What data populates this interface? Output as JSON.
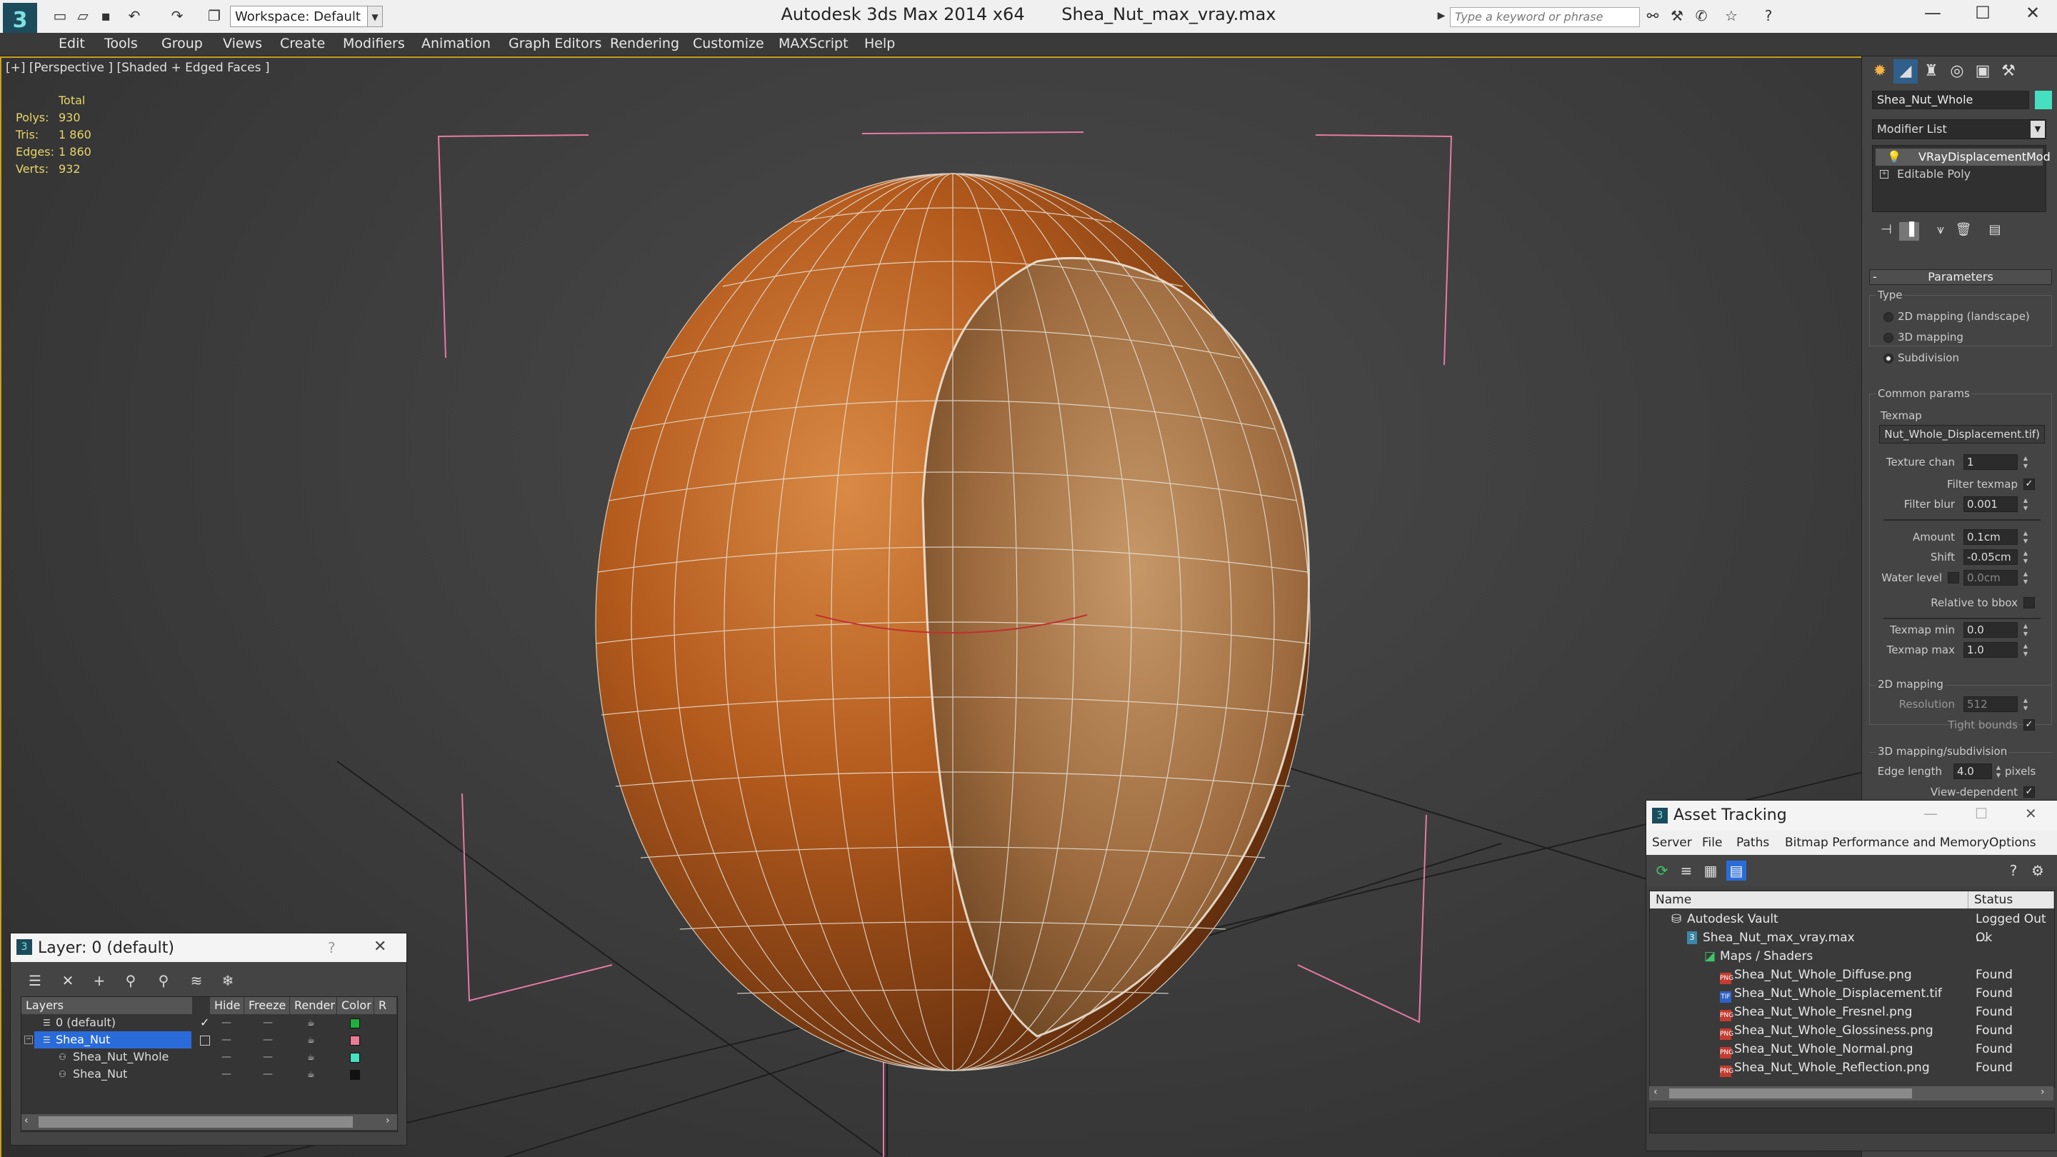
{
  "titlebar": {
    "app_title": "Autodesk 3ds Max  2014 x64",
    "file_title": "Shea_Nut_max_vray.max",
    "workspace": "Workspace: Default",
    "search_placeholder": "Type a keyword or phrase"
  },
  "menu": [
    "Edit",
    "Tools",
    "Group",
    "Views",
    "Create",
    "Modifiers",
    "Animation",
    "Graph Editors",
    "Rendering",
    "Customize",
    "MAXScript",
    "Help"
  ],
  "viewport": {
    "label": "[+] [Perspective ] [Shaded + Edged Faces ]",
    "stats": {
      "header": "Total",
      "polys_label": "Polys:",
      "polys": "930",
      "tris_label": "Tris:",
      "tris": "1 860",
      "edges_label": "Edges:",
      "edges": "1 860",
      "verts_label": "Verts:",
      "verts": "932"
    }
  },
  "command_panel": {
    "object_name": "Shea_Nut_Whole",
    "object_color": "#45e0c0",
    "modifier_list": "Modifier List",
    "stack": [
      "VRayDisplacementMod",
      "Editable Poly"
    ],
    "parameters": {
      "title": "Parameters",
      "type_group": "Type",
      "type_options": [
        "2D mapping (landscape)",
        "3D mapping",
        "Subdivision"
      ],
      "common_group": "Common params",
      "texmap_label": "Texmap",
      "texmap_value": "Nut_Whole_Displacement.tif)",
      "texture_chan_label": "Texture chan",
      "texture_chan": "1",
      "filter_texmap_label": "Filter texmap",
      "filter_blur_label": "Filter blur",
      "filter_blur": "0.001",
      "amount_label": "Amount",
      "amount": "0.1cm",
      "shift_label": "Shift",
      "shift": "-0.05cm",
      "water_level_label": "Water level",
      "water_level": "0.0cm",
      "relative_label": "Relative to bbox",
      "texmap_min_label": "Texmap min",
      "texmap_min": "0.0",
      "texmap_max_label": "Texmap max",
      "texmap_max": "1.0",
      "mapping2d_group": "2D mapping",
      "resolution_label": "Resolution",
      "resolution": "512",
      "tight_bounds_label": "Tight bounds",
      "mapping3d_group": "3D mapping/subdivision",
      "edge_length_label": "Edge length",
      "edge_length": "4.0",
      "pixels_label": "pixels",
      "view_dependent_label": "View-dependent"
    }
  },
  "layer_window": {
    "title": "Layer: 0 (default)",
    "help": "?",
    "columns": [
      "Layers",
      "Hide",
      "Freeze",
      "Render",
      "Color",
      "R"
    ],
    "rows": [
      {
        "name": "0 (default)",
        "color": "#1faf3c"
      },
      {
        "name": "Shea_Nut",
        "color": "#e87a9a"
      },
      {
        "name": "Shea_Nut_Whole",
        "color": "#45e0c0"
      },
      {
        "name": "Shea_Nut",
        "color": "#111111"
      }
    ]
  },
  "asset_window": {
    "title": "Asset Tracking",
    "menu": [
      "Server",
      "File",
      "Paths",
      "Bitmap Performance and Memory",
      "Options"
    ],
    "columns": [
      "Name",
      "Status"
    ],
    "rows": [
      {
        "name": "Autodesk Vault",
        "status": "Logged Out ..."
      },
      {
        "name": "Shea_Nut_max_vray.max",
        "status": "Ok"
      },
      {
        "name": "Maps / Shaders",
        "status": ""
      },
      {
        "name": "Shea_Nut_Whole_Diffuse.png",
        "status": "Found",
        "type": "PNG"
      },
      {
        "name": "Shea_Nut_Whole_Displacement.tif",
        "status": "Found",
        "type": "TIF"
      },
      {
        "name": "Shea_Nut_Whole_Fresnel.png",
        "status": "Found",
        "type": "PNG"
      },
      {
        "name": "Shea_Nut_Whole_Glossiness.png",
        "status": "Found",
        "type": "PNG"
      },
      {
        "name": "Shea_Nut_Whole_Normal.png",
        "status": "Found",
        "type": "PNG"
      },
      {
        "name": "Shea_Nut_Whole_Reflection.png",
        "status": "Found",
        "type": "PNG"
      }
    ]
  }
}
